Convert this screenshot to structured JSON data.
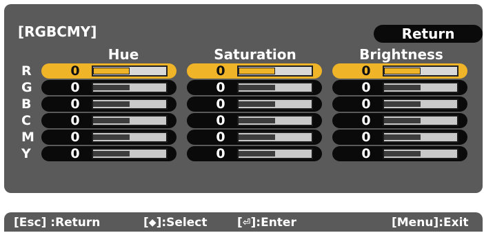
{
  "panel": {
    "title": "[RGBCMY]",
    "return_label": "Return",
    "columns": [
      "Hue",
      "Saturation",
      "Brightness"
    ],
    "rows": [
      {
        "label": "R",
        "values": [
          "0",
          "0",
          "0"
        ],
        "selected": true
      },
      {
        "label": "G",
        "values": [
          "0",
          "0",
          "0"
        ],
        "selected": false
      },
      {
        "label": "B",
        "values": [
          "0",
          "0",
          "0"
        ],
        "selected": false
      },
      {
        "label": "C",
        "values": [
          "0",
          "0",
          "0"
        ],
        "selected": false
      },
      {
        "label": "M",
        "values": [
          "0",
          "0",
          "0"
        ],
        "selected": false
      },
      {
        "label": "Y",
        "values": [
          "0",
          "0",
          "0"
        ],
        "selected": false
      }
    ],
    "slider_level": 0.5
  },
  "footer": {
    "esc": "[Esc] :Return",
    "select_pre": "[",
    "select_icon": "up-down-arrow-icon",
    "select_post": "]:Select",
    "enter_pre": "[",
    "enter_icon": "enter-icon",
    "enter_post": "]:Enter",
    "exit": "[Menu]:Exit"
  },
  "colors": {
    "panel_bg": "#5a5a5a",
    "selected_accent": "#f0b429",
    "control_bg": "#0a0a0a"
  }
}
